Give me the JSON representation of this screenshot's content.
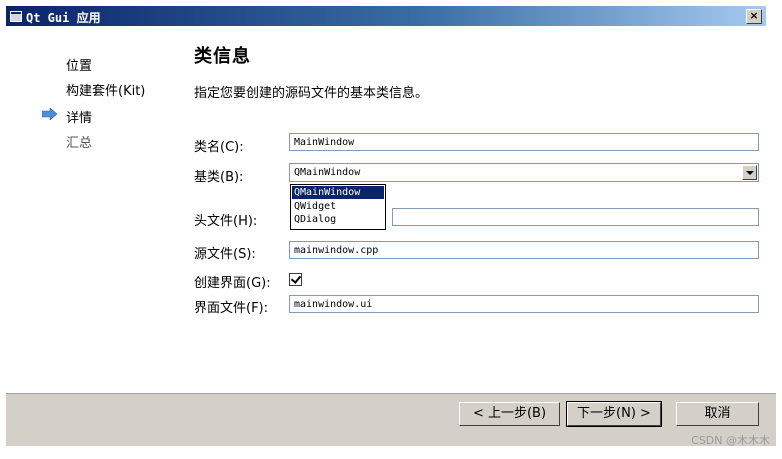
{
  "window": {
    "title": "Qt Gui 应用",
    "close_label": "×"
  },
  "sidebar": {
    "items": [
      {
        "label": "位置",
        "state": "done"
      },
      {
        "label": "构建套件(Kit)",
        "state": "done"
      },
      {
        "label": "详情",
        "state": "current"
      },
      {
        "label": "汇总",
        "state": "pending"
      }
    ]
  },
  "page": {
    "title": "类信息",
    "subtitle": "指定您要创建的源码文件的基本类信息。"
  },
  "form": {
    "class_name": {
      "label": "类名(C):",
      "value": "MainWindow"
    },
    "base_class": {
      "label": "基类(B):",
      "value": "QMainWindow",
      "options": [
        "QMainWindow",
        "QWidget",
        "QDialog"
      ],
      "selected_index": 0
    },
    "header_file": {
      "label": "头文件(H):",
      "value": ""
    },
    "source_file": {
      "label": "源文件(S):",
      "value": "mainwindow.cpp"
    },
    "generate_form": {
      "label": "创建界面(G):",
      "checked": true
    },
    "form_file": {
      "label": "界面文件(F):",
      "value": "mainwindow.ui"
    }
  },
  "buttons": {
    "back": "< 上一步(B)",
    "next": "下一步(N) >",
    "cancel": "取消"
  },
  "watermark": "CSDN @木木木",
  "colors": {
    "selection": "#0a246a",
    "title_gradient_start": "#0a246a",
    "dialog_bg": "#d4d0c8"
  }
}
